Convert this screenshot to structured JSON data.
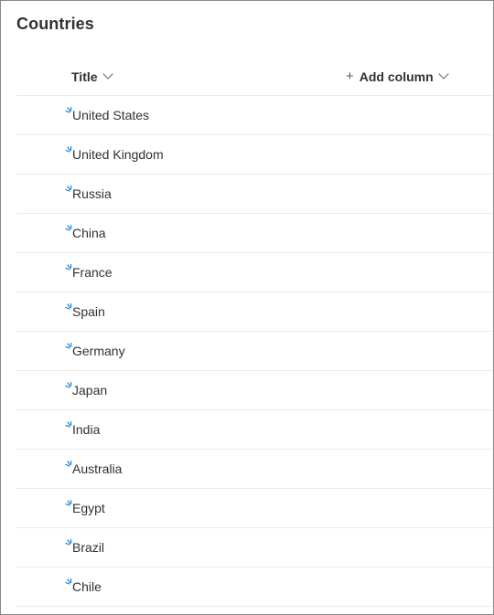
{
  "list": {
    "title": "Countries"
  },
  "header": {
    "title_column": "Title",
    "add_column": "Add column"
  },
  "icons": {
    "new_item": "new-item-sparkle-icon",
    "chevron": "chevron-down-icon",
    "add": "plus-icon"
  },
  "colors": {
    "accent": "#0078d4",
    "text": "#323130",
    "divider": "#edebe9"
  },
  "rows": [
    {
      "title": "United States"
    },
    {
      "title": "United Kingdom"
    },
    {
      "title": "Russia"
    },
    {
      "title": "China"
    },
    {
      "title": "France"
    },
    {
      "title": "Spain"
    },
    {
      "title": "Germany"
    },
    {
      "title": "Japan"
    },
    {
      "title": "India"
    },
    {
      "title": "Australia"
    },
    {
      "title": "Egypt"
    },
    {
      "title": "Brazil"
    },
    {
      "title": "Chile"
    }
  ]
}
